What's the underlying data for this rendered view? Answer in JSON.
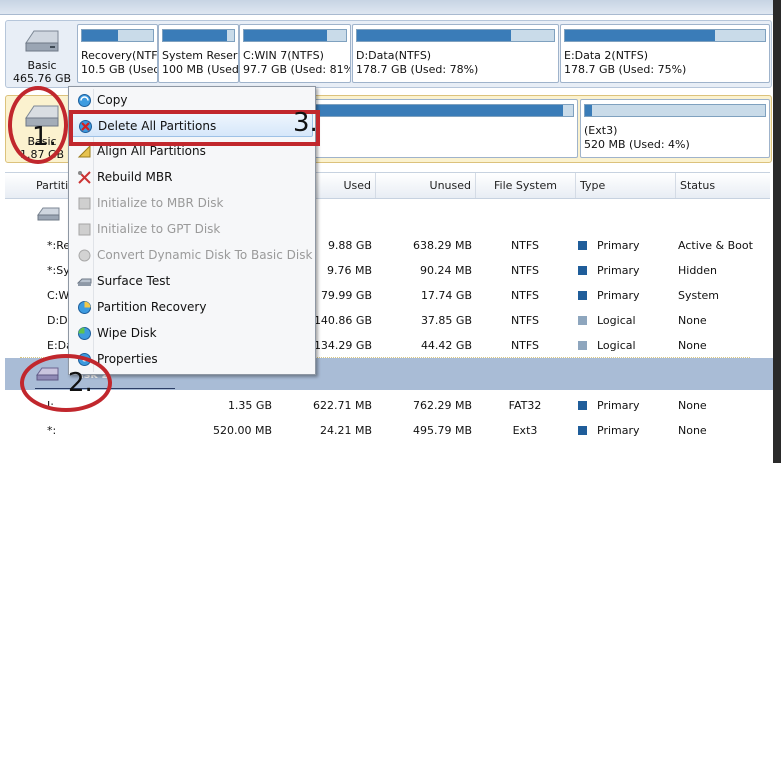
{
  "disk1": {
    "type": "Basic",
    "size": "465.76 GB",
    "partitions": [
      {
        "name": "Recovery(NTF",
        "detail": "10.5 GB (Used",
        "used_fraction": 0.5
      },
      {
        "name": "System Reserv",
        "detail": "100 MB (Used:",
        "used_fraction": 0.9
      },
      {
        "name": "C:WIN 7(NTFS)",
        "detail": "97.7 GB (Used: 81%)",
        "used_fraction": 0.81
      },
      {
        "name": "D:Data(NTFS)",
        "detail": "178.7 GB (Used: 78%)",
        "used_fraction": 0.78
      },
      {
        "name": "E:Data 2(NTFS)",
        "detail": "178.7 GB (Used: 75%)",
        "used_fraction": 0.75
      }
    ]
  },
  "disk2": {
    "type": "Basic",
    "size": "1.87 GB",
    "partitions": [
      {
        "name": "",
        "detail": "",
        "used_fraction": 0.97
      },
      {
        "name": "(Ext3)",
        "detail": "520 MB (Used: 4%)",
        "used_fraction": 0.04
      }
    ]
  },
  "table": {
    "headers": {
      "partition": "Partitio",
      "used": "Used",
      "unused": "Unused",
      "fs": "File System",
      "type": "Type",
      "status": "Status"
    },
    "disk1_rows": [
      {
        "name": "*:Re",
        "used": "9.88 GB",
        "unused": "638.29 MB",
        "fs": "NTFS",
        "type": "Primary",
        "status": "Active & Boot"
      },
      {
        "name": "*:Sy",
        "used": "9.76 MB",
        "unused": "90.24 MB",
        "fs": "NTFS",
        "type": "Primary",
        "status": "Hidden"
      },
      {
        "name": "C:W",
        "used": "79.99 GB",
        "unused": "17.74 GB",
        "fs": "NTFS",
        "type": "Primary",
        "status": "System"
      },
      {
        "name": "D:Da",
        "used": "140.86 GB",
        "unused": "37.85 GB",
        "fs": "NTFS",
        "type": "Logical",
        "status": "None"
      },
      {
        "name": "E:Da",
        "used": "134.29 GB",
        "unused": "44.42 GB",
        "fs": "NTFS",
        "type": "Logical",
        "status": "None"
      }
    ],
    "disk2_label": "isk 2",
    "disk2_rows": [
      {
        "name": "I:",
        "capacity": "1.35 GB",
        "used": "622.71 MB",
        "unused": "762.29 MB",
        "fs": "FAT32",
        "type": "Primary",
        "status": "None"
      },
      {
        "name": "*:",
        "capacity": "520.00 MB",
        "used": "24.21 MB",
        "unused": "495.79 MB",
        "fs": "Ext3",
        "type": "Primary",
        "status": "None"
      }
    ]
  },
  "context_menu": {
    "items": [
      {
        "label": "Copy",
        "enabled": true
      },
      {
        "label": "Delete All Partitions",
        "enabled": true,
        "highlighted": true
      },
      {
        "label": "Align All Partitions",
        "enabled": true
      },
      {
        "label": "Rebuild MBR",
        "enabled": true
      },
      {
        "label": "Initialize to MBR Disk",
        "enabled": false
      },
      {
        "label": "Initialize to GPT Disk",
        "enabled": false
      },
      {
        "label": "Convert Dynamic Disk To Basic Disk",
        "enabled": false
      },
      {
        "label": "Surface Test",
        "enabled": true
      },
      {
        "label": "Partition Recovery",
        "enabled": true
      },
      {
        "label": "Wipe Disk",
        "enabled": true
      },
      {
        "label": "Properties",
        "enabled": true
      }
    ]
  },
  "annotations": {
    "step1": "1.",
    "step2": "2.",
    "step3": "3."
  },
  "colors": {
    "primary": "#1f5d9a",
    "logical": "#8ea6be",
    "annotation": "#c1272d",
    "used_fill": "#3a7cb8"
  }
}
